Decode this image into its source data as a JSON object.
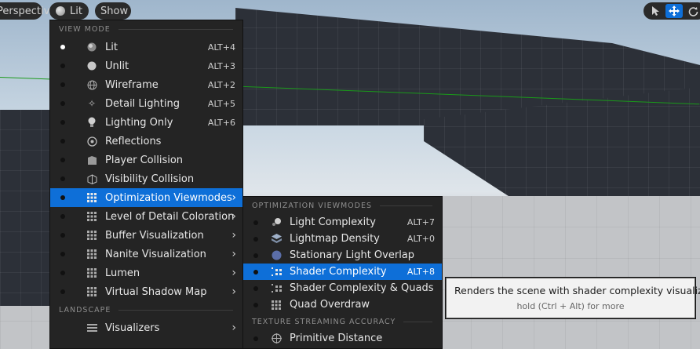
{
  "toolbar": {
    "perspective_label": "Perspective",
    "lit_label": "Lit",
    "show_label": "Show",
    "right_tools": [
      {
        "icon": "select-arrow-icon",
        "active": false
      },
      {
        "icon": "move-icon",
        "active": true
      },
      {
        "icon": "rotate-icon",
        "active": false
      }
    ]
  },
  "main_menu": {
    "view_mode_header": "VIEW MODE",
    "items": [
      {
        "label": "Lit",
        "shortcut": "ALT+4",
        "icon": "lit-sphere-icon",
        "active": true
      },
      {
        "label": "Unlit",
        "shortcut": "ALT+3",
        "icon": "unlit-sphere-icon"
      },
      {
        "label": "Wireframe",
        "shortcut": "ALT+2",
        "icon": "wireframe-icon"
      },
      {
        "label": "Detail Lighting",
        "shortcut": "ALT+5",
        "icon": "detail-lighting-icon"
      },
      {
        "label": "Lighting Only",
        "shortcut": "ALT+6",
        "icon": "bulb-icon"
      },
      {
        "label": "Reflections",
        "shortcut": "",
        "icon": "reflections-icon"
      },
      {
        "label": "Player Collision",
        "shortcut": "",
        "icon": "player-collision-icon"
      },
      {
        "label": "Visibility Collision",
        "shortcut": "",
        "icon": "visibility-collision-icon"
      },
      {
        "label": "Optimization Viewmodes",
        "submenu": true,
        "icon": "grid-icon",
        "highlight": true
      },
      {
        "label": "Level of Detail Coloration",
        "submenu": true,
        "icon": "grid-icon"
      },
      {
        "label": "Buffer Visualization",
        "submenu": true,
        "icon": "grid-icon"
      },
      {
        "label": "Nanite Visualization",
        "submenu": true,
        "icon": "grid-icon"
      },
      {
        "label": "Lumen",
        "submenu": true,
        "icon": "grid-icon"
      },
      {
        "label": "Virtual Shadow Map",
        "submenu": true,
        "icon": "grid-icon"
      }
    ],
    "landscape_header": "LANDSCAPE",
    "landscape_items": [
      {
        "label": "Visualizers",
        "submenu": true,
        "icon": "visualizers-icon"
      }
    ]
  },
  "sub_menu": {
    "optimization_header": "OPTIMIZATION VIEWMODES",
    "items": [
      {
        "label": "Light Complexity",
        "shortcut": "ALT+7",
        "icon": "light-complexity-icon"
      },
      {
        "label": "Lightmap Density",
        "shortcut": "ALT+0",
        "icon": "lightmap-density-icon"
      },
      {
        "label": "Stationary Light Overlap",
        "shortcut": "",
        "icon": "stationary-light-icon"
      },
      {
        "label": "Shader Complexity",
        "shortcut": "ALT+8",
        "icon": "shader-complexity-icon",
        "highlight": true
      },
      {
        "label": "Shader Complexity & Quads",
        "shortcut": "",
        "icon": "shader-quads-icon"
      },
      {
        "label": "Quad Overdraw",
        "shortcut": "",
        "icon": "quad-overdraw-icon"
      }
    ],
    "texture_header": "TEXTURE STREAMING ACCURACY",
    "texture_items": [
      {
        "label": "Primitive Distance",
        "shortcut": "",
        "icon": "crosshair-icon"
      }
    ]
  },
  "tooltip": {
    "title": "Renders the scene with shader complexity visualization",
    "subtitle": "hold (Ctrl + Alt) for more"
  }
}
